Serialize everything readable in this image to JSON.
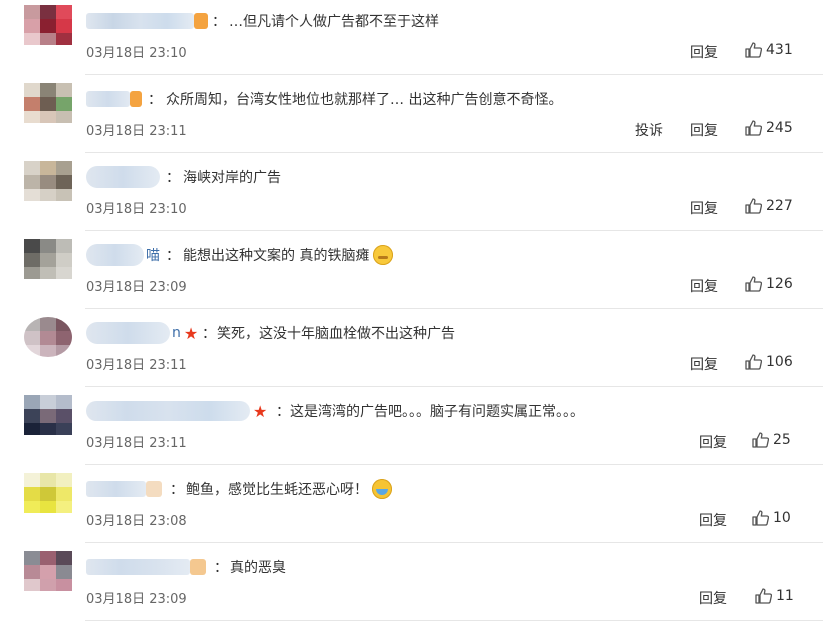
{
  "comments": [
    {
      "content": "…但凡请个人做广告都不至于这样",
      "time": "03月18日 23:10",
      "reply": "回复",
      "likes": "431",
      "avatar_colors": [
        "#c89a9e",
        "#7a3040",
        "#e04a5a",
        "#d8a0a8",
        "#8a2030",
        "#d63848",
        "#e9c8cc",
        "#b88088",
        "#a03040"
      ],
      "name_tail_color": "#f4a340"
    },
    {
      "content": "众所周知，台湾女性地位也就那样了… 出这种广告创意不奇怪。",
      "time": "03月18日 23:11",
      "report": "投诉",
      "reply": "回复",
      "likes": "245",
      "avatar_colors": [
        "#e0d8cc",
        "#8a8476",
        "#c8c0b2",
        "#c47f6c",
        "#6e5e52",
        "#76a46a",
        "#e8dccf",
        "#d8c6b8",
        "#c8bfb2"
      ],
      "name_tail_color": "#f4a340"
    },
    {
      "content": "海峡对岸的广告",
      "time": "03月18日 23:10",
      "reply": "回复",
      "likes": "227",
      "avatar_colors": [
        "#d8d2c8",
        "#c8b69a",
        "#a8a090",
        "#bcb4a8",
        "#988c80",
        "#6e6458",
        "#e4ded6",
        "#d6d0c6",
        "#c8c2b6"
      ],
      "name_tail_color": ""
    },
    {
      "name_visible": "喵",
      "content": "能想出这种文案的 真的铁脑瘫",
      "emoji": "sweat",
      "time": "03月18日 23:09",
      "reply": "回复",
      "likes": "126",
      "avatar_colors": [
        "#4a4a4a",
        "#8a8a86",
        "#bdbcb6",
        "#6e6c66",
        "#a4a29a",
        "#cfcdc6",
        "#9c9a92",
        "#c0beb6",
        "#d8d6d0"
      ],
      "name_tail_color": ""
    },
    {
      "name_visible": "n",
      "content": "笑死，这没十年脑血栓做不出这种广告",
      "time": "03月18日 23:11",
      "reply": "回复",
      "likes": "106",
      "avatar_colors": [
        "#b8b4b4",
        "#9a8a8e",
        "#7a5660",
        "#cfc2c6",
        "#b28a94",
        "#8e6470",
        "#e2d6da",
        "#cbb4bc",
        "#b49aa4"
      ],
      "name_tail_color": ""
    },
    {
      "content": "这是湾湾的广告吧。。。脑子有问题实属正常。。。",
      "time": "03月18日 23:11",
      "reply": "回复",
      "likes": "25",
      "avatar_colors": [
        "#9aa6b6",
        "#c8ced8",
        "#b4bccb",
        "#3c4358",
        "#7a6a78",
        "#5a5068",
        "#1a2238",
        "#2a3048",
        "#3a4058"
      ],
      "name_tail_color": ""
    },
    {
      "content": "鲍鱼，感觉比生蚝还恶心呀！",
      "emoji": "laugh",
      "time": "03月18日 23:08",
      "reply": "回复",
      "likes": "10",
      "avatar_colors": [
        "#f4f2d8",
        "#e8e6a8",
        "#f2f0c0",
        "#e4dc46",
        "#cfc838",
        "#eee868",
        "#f0ec58",
        "#e8e440",
        "#f4f080"
      ],
      "name_tail_color": "#f4dcc0"
    },
    {
      "content": "真的恶臭",
      "time": "03月18日 23:09",
      "reply": "回复",
      "likes": "11",
      "avatar_colors": [
        "#8a8c94",
        "#9a6070",
        "#5a4a58",
        "#b88a96",
        "#d4a0ac",
        "#8a8a92",
        "#e0c8cc",
        "#d0a0ac",
        "#c890a0"
      ],
      "name_tail_color": "#f4c890"
    }
  ]
}
